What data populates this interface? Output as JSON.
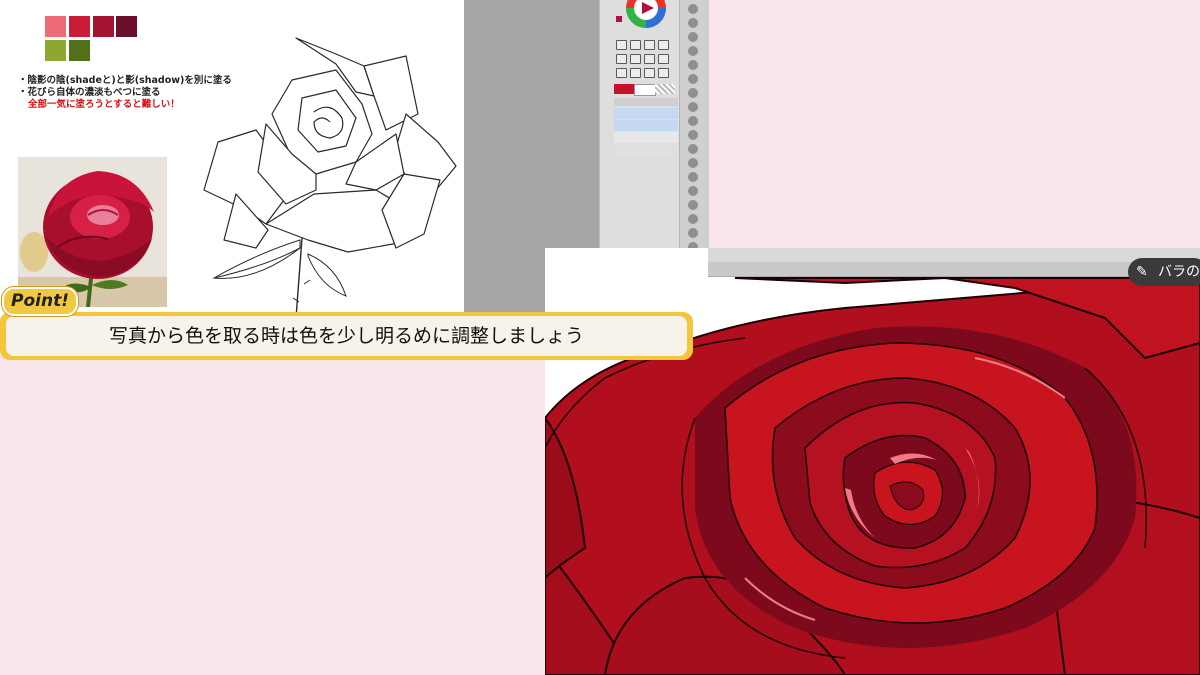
{
  "palette": {
    "swatches": [
      "#ee6a79",
      "#c91d3a",
      "#a41534",
      "#6c0f2b",
      "#8ea632",
      "#526f1a",
      "#2d4b15"
    ]
  },
  "notes": {
    "line1": "・陰影の陰(shadeと)と影(shadow)を別に塗る",
    "line2": "・花びら自体の濃淡もべつに塗る",
    "line3": "全部一気に塗ろうとすると難しい！"
  },
  "point": {
    "badge": "Point!",
    "tip": "写真から色を取る時は色を少し明るめに調整しましょう"
  },
  "badge": {
    "label": "バラの"
  },
  "colors": {
    "background": "#fbe6ec",
    "banner": "#f3c63c",
    "rose_dark": "#7d0a1c",
    "rose_mid": "#b5101f",
    "rose_light": "#d41f2c",
    "rose_highlight": "#f07b86"
  }
}
